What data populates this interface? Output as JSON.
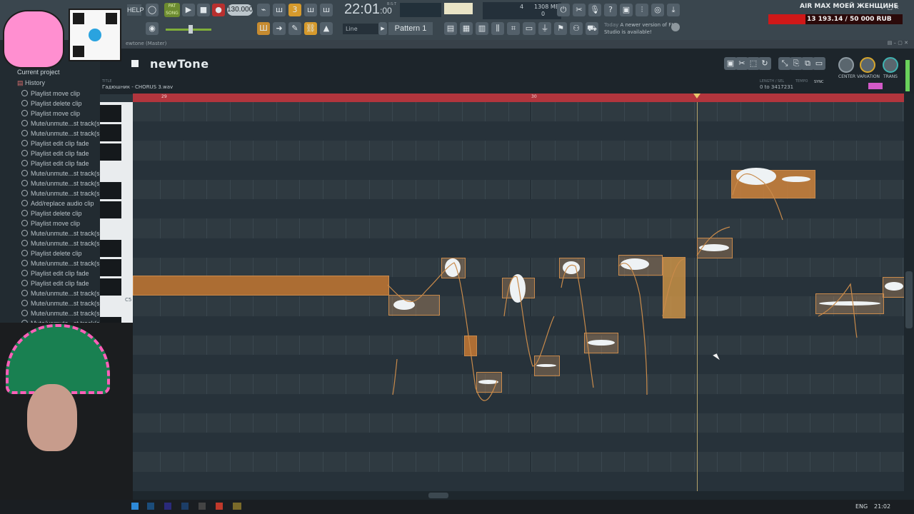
{
  "toolbar": {
    "help": "HELP",
    "song_mode": "SONG",
    "tempo": "130.000",
    "time_main": "22:01",
    "time_frac": "00",
    "time_label": "B:S:T",
    "memory": "1308 MB",
    "cpu_val": "4",
    "voices": "0",
    "snap": "Line",
    "pattern": "Pattern 1",
    "hint_date": "Today",
    "hint_text": "A newer version of FL Studio is available!"
  },
  "ad": {
    "title": "AIR MAX МОЕЙ ЖЕНЩИНЕ",
    "amount": "13 193.14 / 50 000 RUB"
  },
  "plugin_window": {
    "title": "ewtone (Master)",
    "logo": "newTone",
    "file_label": "TITLE",
    "file": "Гадюшник - CHORUS 3.wav",
    "length_label": "LENGTH / SEL",
    "length": "0 to 3417231",
    "tempo_label": "TEMPO",
    "sync": "SYNC",
    "knobs": [
      "CENTER",
      "VARIATION",
      "TRANS"
    ]
  },
  "ruler": {
    "bar_29": "29",
    "bar_30": "30"
  },
  "keyboard": {
    "c5": "C5"
  },
  "browser": {
    "root": "Current project",
    "history": "History",
    "items": [
      "Playlist move clip",
      "Playlist delete clip",
      "Playlist move clip",
      "Mute/unmute...st track(s)",
      "Mute/unmute...st track(s)",
      "Playlist edit clip fade",
      "Playlist edit clip fade",
      "Playlist edit clip fade",
      "Mute/unmute...st track(s)",
      "Mute/unmute...st track(s)",
      "Mute/unmute...st track(s)",
      "Add/replace audio clip",
      "Playlist delete clip",
      "Playlist move clip",
      "Mute/unmute...st track(s)",
      "Mute/unmute...st track(s)",
      "Playlist delete clip",
      "Mute/unmute...st track(s)",
      "Playlist edit clip fade",
      "Playlist edit clip fade",
      "Mute/unmute...st track(s)",
      "Mute/unmute...st track(s)",
      "Mute/unmute...st track(s)",
      "Mute/unmute...st track(s)"
    ]
  },
  "taskbar": {
    "lang": "ENG",
    "time": "21:02"
  },
  "colors": {
    "accent": "#b2353d",
    "note": "#c98a4c",
    "song": "#6c8b30"
  }
}
